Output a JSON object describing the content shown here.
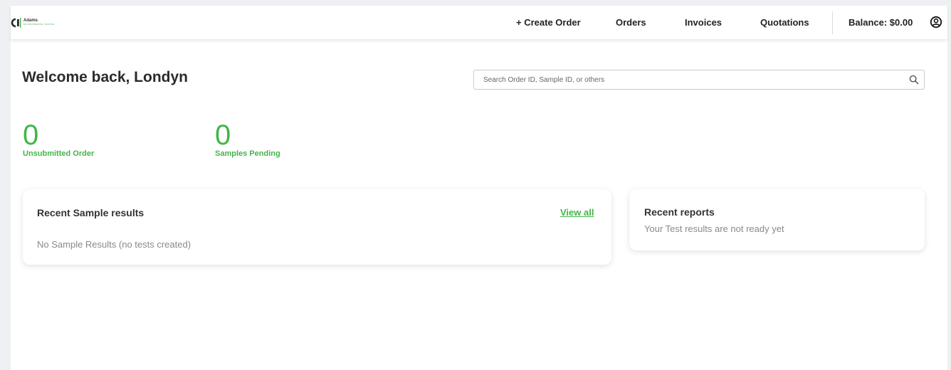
{
  "header": {
    "logo": {
      "name": "Adams",
      "subtitle": "ENVIRONMENTAL TESTING"
    },
    "nav": {
      "create_order": "+ Create Order",
      "orders": "Orders",
      "invoices": "Invoices",
      "quotations": "Quotations",
      "balance": "Balance: $0.00"
    },
    "icons": {
      "user": "user-circle-icon"
    }
  },
  "main": {
    "welcome": "Welcome back, Londyn",
    "search": {
      "placeholder": "Search Order ID, Sample ID, or others",
      "value": ""
    },
    "stats": [
      {
        "value": "0",
        "label": "Unsubmitted Order"
      },
      {
        "value": "0",
        "label": "Samples Pending"
      }
    ],
    "recent_samples": {
      "title": "Recent Sample results",
      "view_all": "View all",
      "empty_text": "No Sample Results (no tests created)"
    },
    "recent_reports": {
      "title": "Recent reports",
      "empty_text": "Your Test results are not ready yet"
    }
  },
  "colors": {
    "accent": "#43b54a",
    "background": "#eef0f3"
  }
}
